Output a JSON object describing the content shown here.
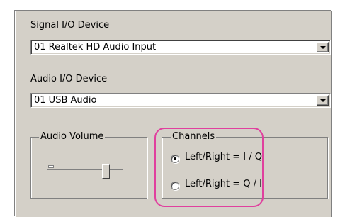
{
  "signal_io": {
    "label": "Signal I/O Device",
    "selected": "01  Realtek HD Audio Input"
  },
  "audio_io": {
    "label": "Audio I/O Device",
    "selected": "01  USB Audio"
  },
  "audio_volume": {
    "title": "Audio Volume",
    "level": 0.8
  },
  "channels": {
    "title": "Channels",
    "options": [
      {
        "label": "Left/Right = I / Q",
        "selected": true
      },
      {
        "label": "Left/Right = Q / I",
        "selected": false
      }
    ],
    "highlight_color": "#e0409e"
  },
  "icons": [
    "dropdown-arrow-icon",
    "radio-dot-icon"
  ]
}
